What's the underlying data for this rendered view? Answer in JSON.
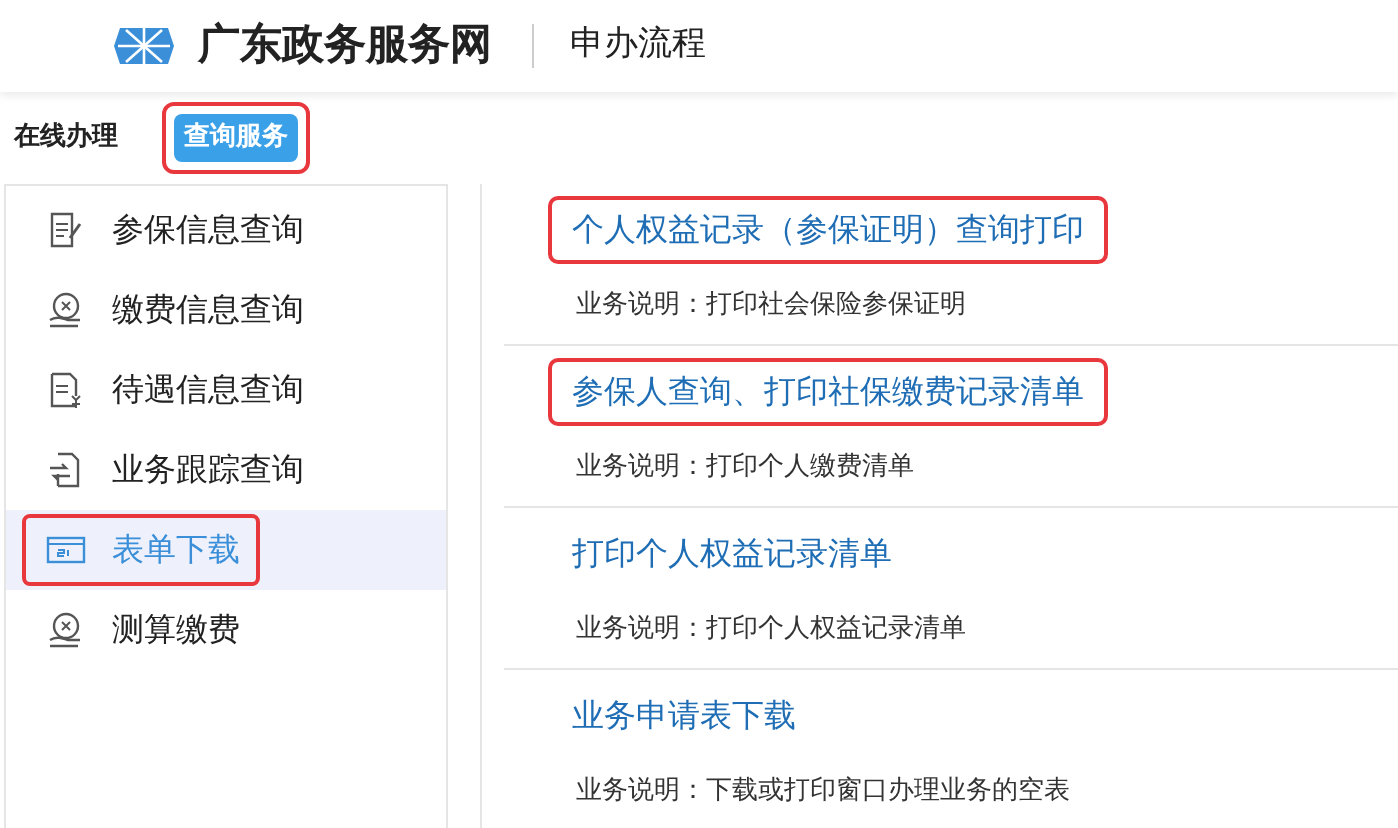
{
  "header": {
    "site_name": "广东政务服务网",
    "page_title": "申办流程"
  },
  "section": {
    "label": "在线办理",
    "tag": {
      "text": "查询服务",
      "highlighted": true
    }
  },
  "sidebar": {
    "items": [
      {
        "label": "参保信息查询",
        "kind": "doc-pen",
        "selected": false,
        "highlighted": false
      },
      {
        "label": "缴费信息查询",
        "kind": "coin-hand",
        "selected": false,
        "highlighted": false
      },
      {
        "label": "待遇信息查询",
        "kind": "doc-yen",
        "selected": false,
        "highlighted": false
      },
      {
        "label": "业务跟踪查询",
        "kind": "doc-arrows",
        "selected": false,
        "highlighted": false
      },
      {
        "label": "表单下载",
        "kind": "si-card",
        "selected": true,
        "highlighted": true
      },
      {
        "label": "测算缴费",
        "kind": "coin-hand",
        "selected": false,
        "highlighted": false
      }
    ]
  },
  "services": [
    {
      "title": "个人权益记录（参保证明）查询打印",
      "description": "业务说明：打印社会保险参保证明",
      "highlighted": true
    },
    {
      "title": "参保人查询、打印社保缴费记录清单",
      "description": "业务说明：打印个人缴费清单",
      "highlighted": true
    },
    {
      "title": "打印个人权益记录清单",
      "description": "业务说明：打印个人权益记录清单",
      "highlighted": false
    },
    {
      "title": "业务申请表下载",
      "description": "业务说明：下载或打印窗口办理业务的空表",
      "highlighted": false
    }
  ]
}
